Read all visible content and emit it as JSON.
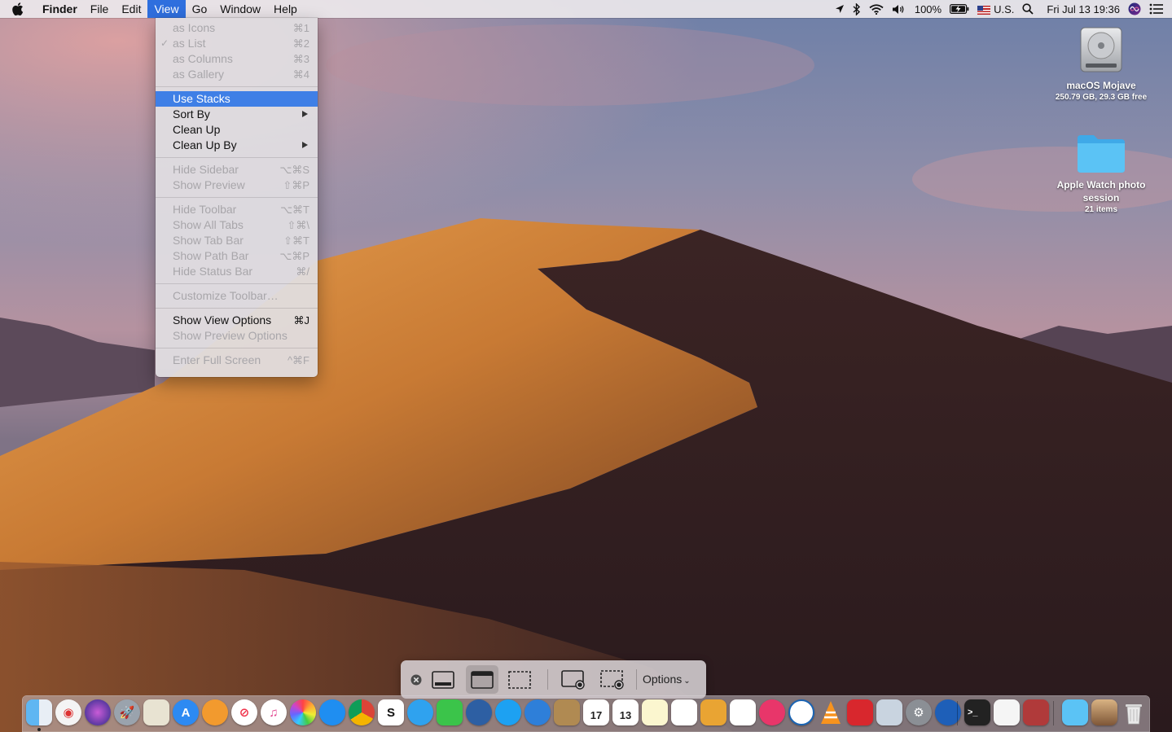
{
  "menubar": {
    "app_name": "Finder",
    "menus": [
      "File",
      "Edit",
      "View",
      "Go",
      "Window",
      "Help"
    ],
    "active_menu": "View",
    "status": {
      "battery": "100%",
      "input_source": "U.S.",
      "clock": "Fri Jul 13  19:36"
    }
  },
  "view_menu": {
    "items": [
      {
        "label": "as Icons",
        "shortcut": "⌘1"
      },
      {
        "label": "as List",
        "shortcut": "⌘2",
        "checked": "✓"
      },
      {
        "label": "as Columns",
        "shortcut": "⌘3"
      },
      {
        "label": "as Gallery",
        "shortcut": "⌘4"
      },
      {
        "label": "Use Stacks"
      },
      {
        "label": "Sort By"
      },
      {
        "label": "Clean Up"
      },
      {
        "label": "Clean Up By"
      },
      {
        "label": "Hide Sidebar",
        "shortcut": "⌥⌘S"
      },
      {
        "label": "Show Preview",
        "shortcut": "⇧⌘P"
      },
      {
        "label": "Hide Toolbar",
        "shortcut": "⌥⌘T"
      },
      {
        "label": "Show All Tabs",
        "shortcut": "⇧⌘\\"
      },
      {
        "label": "Show Tab Bar",
        "shortcut": "⇧⌘T"
      },
      {
        "label": "Show Path Bar",
        "shortcut": "⌥⌘P"
      },
      {
        "label": "Hide Status Bar",
        "shortcut": "⌘/"
      },
      {
        "label": "Customize Toolbar…"
      },
      {
        "label": "Show View Options",
        "shortcut": "⌘J"
      },
      {
        "label": "Show Preview Options"
      },
      {
        "label": "Enter Full Screen",
        "shortcut": "^⌘F"
      }
    ]
  },
  "desktop": {
    "drive": {
      "name": "macOS Mojave",
      "info": "250.79 GB, 29.3 GB free"
    },
    "folder": {
      "name": "Apple Watch photo session",
      "info": "21 items"
    }
  },
  "screenshot_toolbar": {
    "options_label": "Options"
  },
  "dock": {
    "calendar_day": "17",
    "reminder_day": "13",
    "skitch_letter": "S"
  },
  "colors": {
    "menu_highlight": "#3f7fe6",
    "menubar_active": "#2f6fde",
    "folder_blue": "#5bc3f5"
  }
}
